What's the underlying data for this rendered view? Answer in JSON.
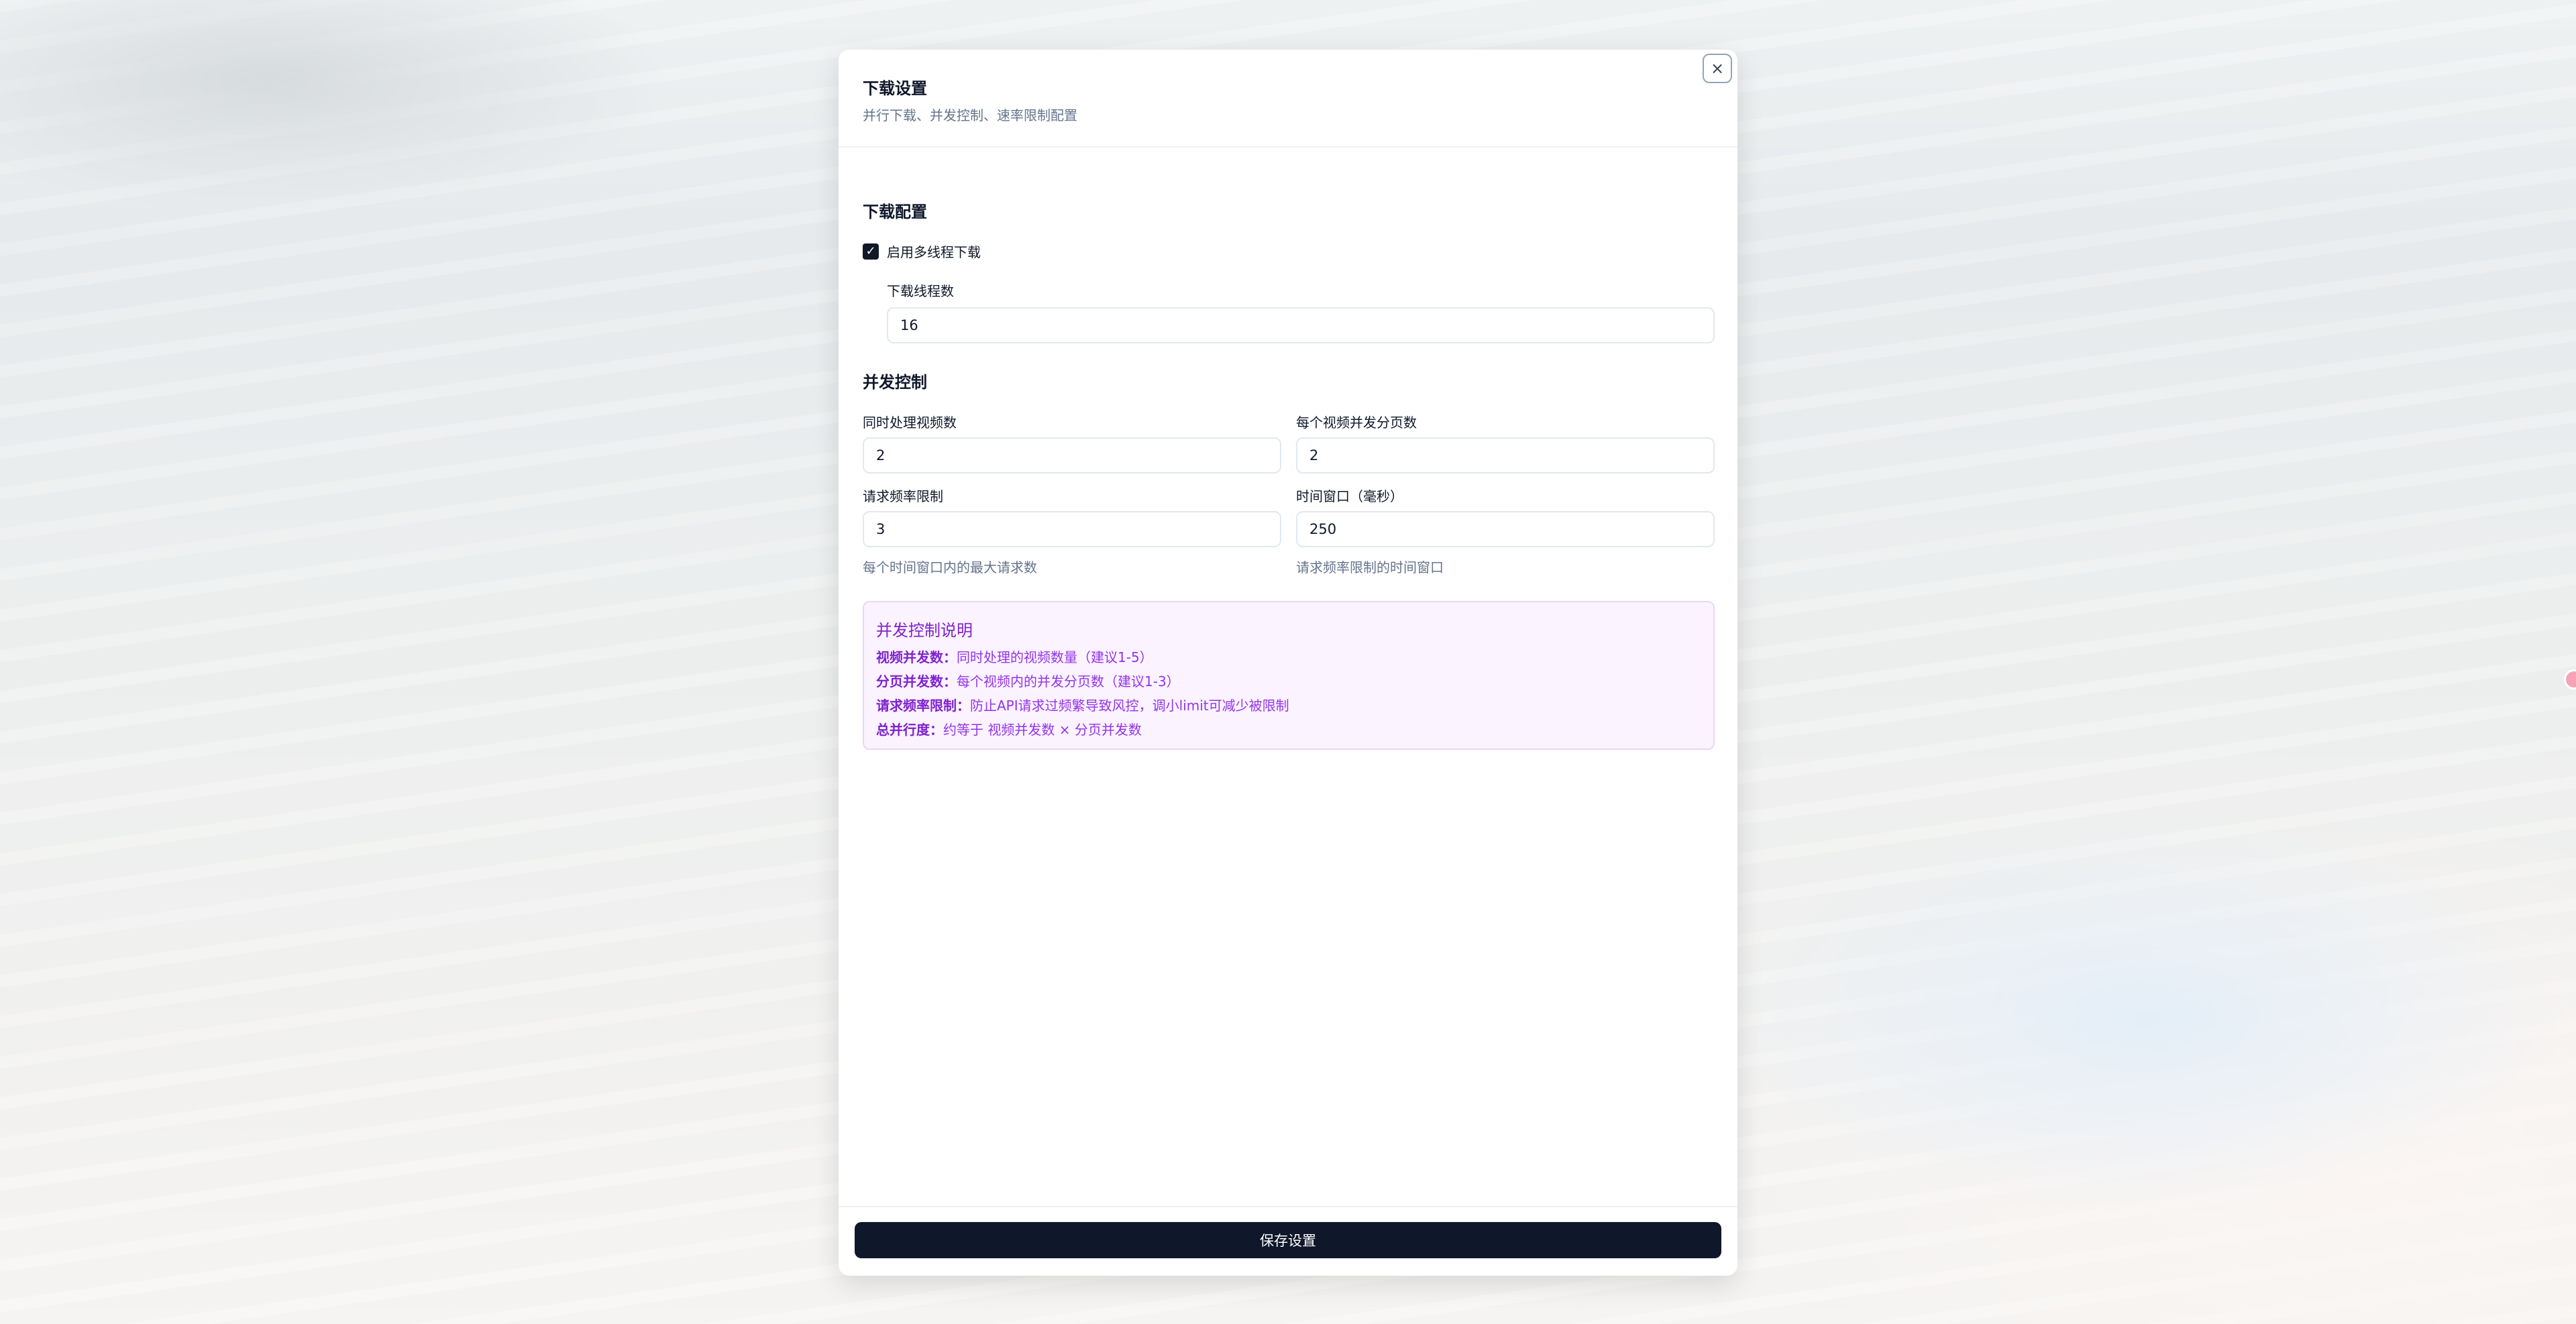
{
  "modal": {
    "title": "下载设置",
    "subtitle": "并行下载、并发控制、速率限制配置",
    "close_symbol": "×"
  },
  "download_config": {
    "section_title": "下载配置",
    "multithread_checkbox": {
      "label": "启用多线程下载",
      "checked": true,
      "check_symbol": "✓"
    },
    "thread_count": {
      "label": "下载线程数",
      "value": "16"
    }
  },
  "concurrency": {
    "section_title": "并发控制",
    "videos_at_once": {
      "label": "同时处理视频数",
      "value": "2"
    },
    "pages_per_video": {
      "label": "每个视频并发分页数",
      "value": "2"
    },
    "rate_limit": {
      "label": "请求频率限制",
      "value": "3",
      "hint": "每个时间窗口内的最大请求数"
    },
    "time_window": {
      "label": "时间窗口（毫秒）",
      "value": "250",
      "hint": "请求频率限制的时间窗口"
    }
  },
  "info_box": {
    "title": "并发控制说明",
    "lines": [
      {
        "key": "视频并发数：",
        "text": "同时处理的视频数量（建议1-5）"
      },
      {
        "key": "分页并发数：",
        "text": "每个视频内的并发分页数（建议1-3）"
      },
      {
        "key": "请求频率限制：",
        "text": "防止API请求过频繁导致风控，调小limit可减少被限制"
      },
      {
        "key": "总并行度：",
        "text": "约等于 视频并发数 × 分页并发数"
      }
    ]
  },
  "footer": {
    "save_label": "保存设置"
  },
  "colors": {
    "primary": "#0f172a",
    "info_bg": "#fbf3ff",
    "info_accent": "#7e22ce"
  }
}
